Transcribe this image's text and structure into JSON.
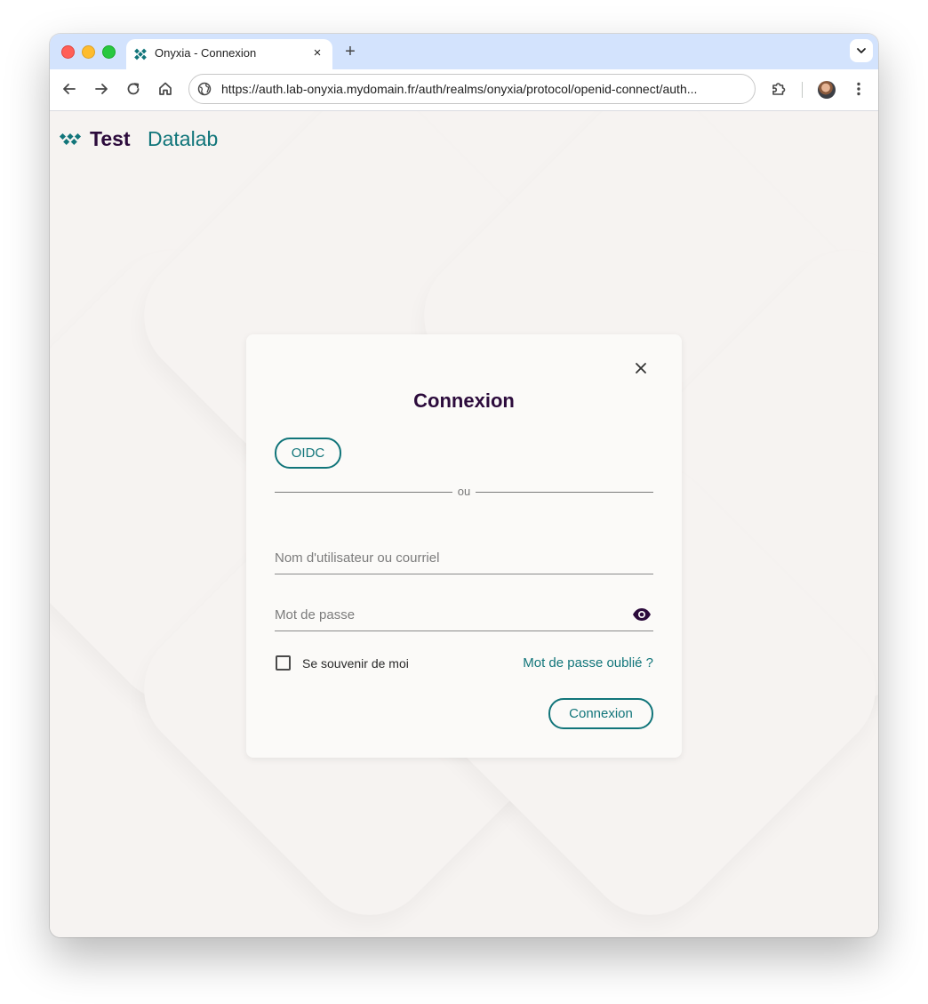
{
  "browser": {
    "tab": {
      "title": "Onyxia - Connexion",
      "close_glyph": "×"
    },
    "new_tab_glyph": "+",
    "url": "https://auth.lab-onyxia.mydomain.fr/auth/realms/onyxia/protocol/openid-connect/auth..."
  },
  "header": {
    "brand_primary": "Test",
    "brand_secondary": "Datalab"
  },
  "login": {
    "title": "Connexion",
    "provider_button": "OIDC",
    "divider": "ou",
    "username_placeholder": "Nom d'utilisateur ou courriel",
    "username_value": "",
    "password_placeholder": "Mot de passe",
    "password_value": "",
    "remember_label": "Se souvenir de moi",
    "remember_checked": false,
    "forgot_link": "Mot de passe oublié ?",
    "submit": "Connexion"
  },
  "colors": {
    "accent": "#11757a",
    "title": "#2c0b3c",
    "page_background": "#f6f3f1",
    "tab_strip": "#d3e3fd"
  },
  "icons": {
    "tab_favicon": "onyxia-logo-icon",
    "back": "back-arrow-icon",
    "forward": "forward-arrow-icon",
    "reload": "reload-icon",
    "home": "home-icon",
    "site_info": "globe-icon",
    "extensions": "puzzle-icon",
    "menu": "kebab-menu-icon",
    "close": "close-icon",
    "password_visibility": "eye-icon"
  }
}
